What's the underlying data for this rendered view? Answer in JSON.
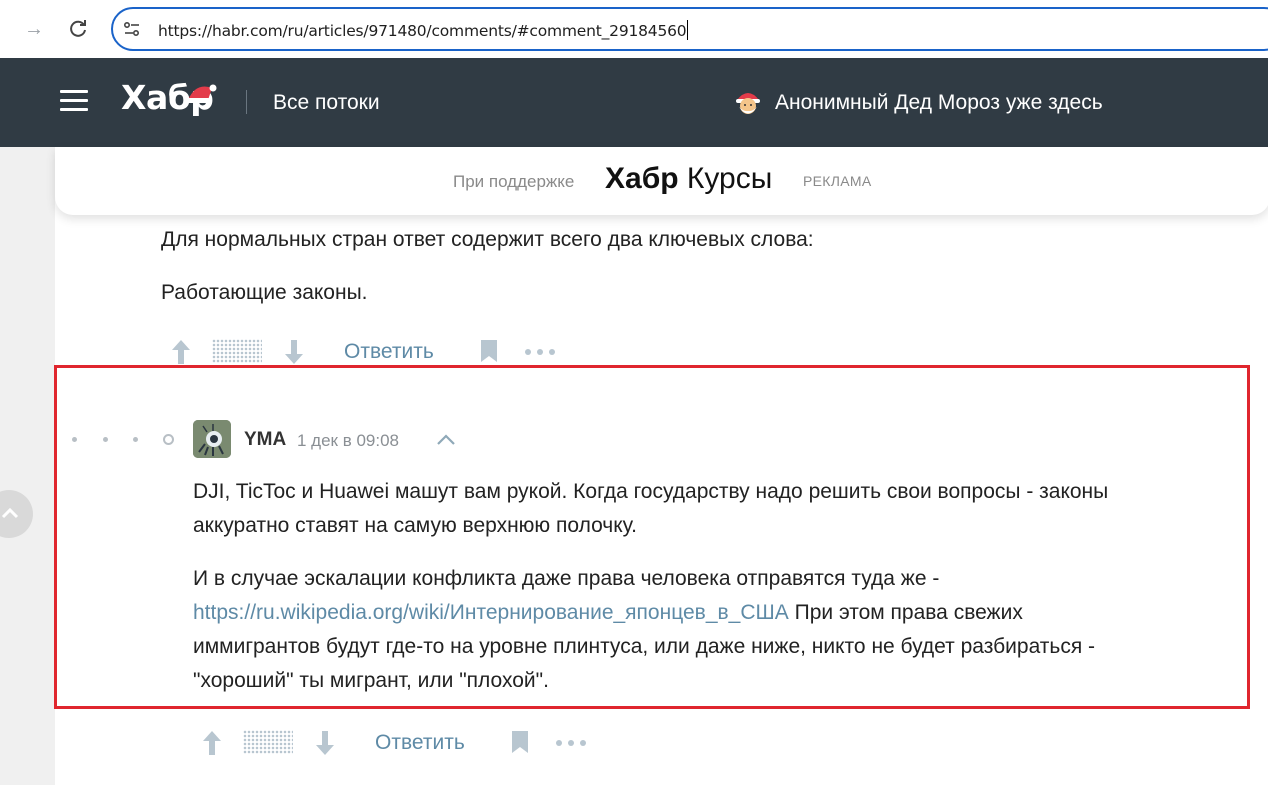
{
  "browser": {
    "url": "https://habr.com/ru/articles/971480/comments/#comment_29184560"
  },
  "header": {
    "logo": "Хабр",
    "nav_all_flows": "Все потоки",
    "santa_text": "Анонимный Дед Мороз уже здесь"
  },
  "banner": {
    "support_label": "При поддержке",
    "brand_bold": "Хабр",
    "brand_light": "Курсы",
    "ad_label": "РЕКЛАМА"
  },
  "prev_comment": {
    "lines": [
      "Для нормальных стран ответ содержит всего два ключевых слова:",
      "Работающие законы."
    ],
    "reply_label": "Ответить"
  },
  "comment": {
    "author": "YMA",
    "timestamp": "1 дек в 09:08",
    "para1_line1": "DJI, TicToc и Huawei машут вам рукой. Когда государству надо решить свои вопросы - законы",
    "para1_line2": "аккуратно ставят на самую верхнюю полочку.",
    "para2_line1": "И в случае эскалации конфликта даже права человека отправятся туда же -",
    "para2_link": "https://ru.wikipedia.org/wiki/Интернирование_японцев_в_США",
    "para2_line2_rest": " При этом права свежих",
    "para2_line3": "иммигрантов будут где-то на уровне плинтуса, или даже ниже, никто не будет разбираться -",
    "para2_line4": "\"хороший\" ты мигрант, или \"плохой\".",
    "reply_label": "Ответить"
  },
  "colors": {
    "header_bg": "#303b44",
    "link": "#5e8aa6",
    "highlight": "#e0262e"
  }
}
